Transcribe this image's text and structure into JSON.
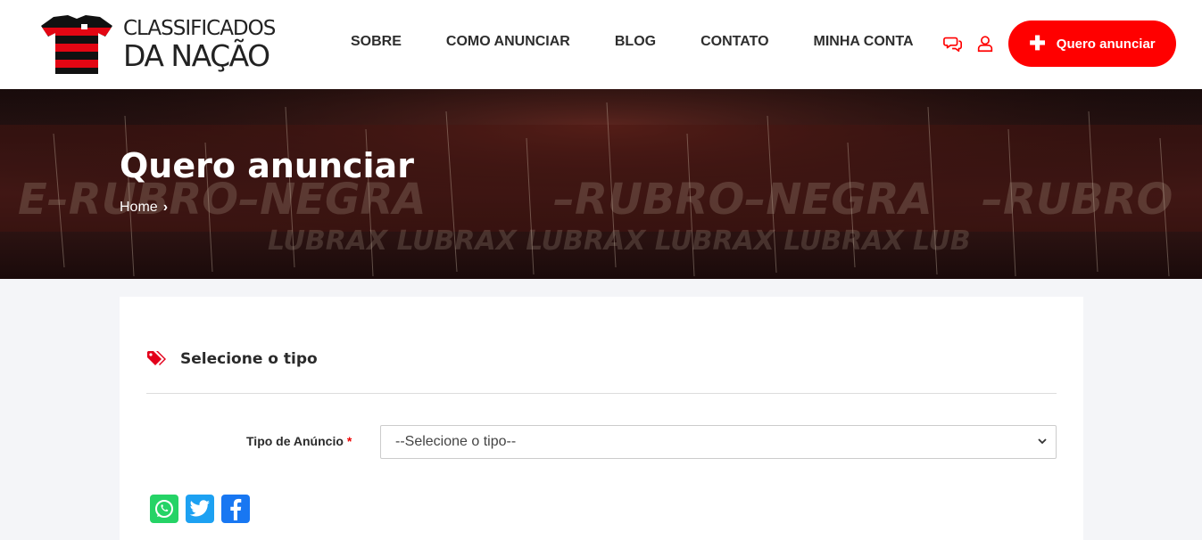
{
  "header": {
    "logo_line1": "CLASSIFICADOS",
    "logo_line2": "DA NAÇÃO",
    "nav": [
      {
        "label": "SOBRE"
      },
      {
        "label": "COMO ANUNCIAR"
      },
      {
        "label": "BLOG"
      },
      {
        "label": "CONTATO"
      },
      {
        "label": "MINHA CONTA"
      }
    ],
    "icons": [
      "chat-icon",
      "user-icon"
    ],
    "cta_label": "Quero anunciar",
    "cta_icon": "plus-icon"
  },
  "banner": {
    "title": "Quero anunciar",
    "breadcrumb": [
      "Home"
    ]
  },
  "form": {
    "section_title": "Selecione o tipo",
    "section_icon": "tags-icon",
    "field_label": "Tipo de Anúncio",
    "required_mark": "*",
    "select_value": "--Selecione o tipo--"
  },
  "share": [
    "whatsapp-icon",
    "twitter-icon",
    "facebook-icon"
  ],
  "colors": {
    "accent": "#ff0000",
    "whatsapp": "#25d366",
    "twitter": "#1da1f2",
    "facebook": "#1877f2"
  }
}
